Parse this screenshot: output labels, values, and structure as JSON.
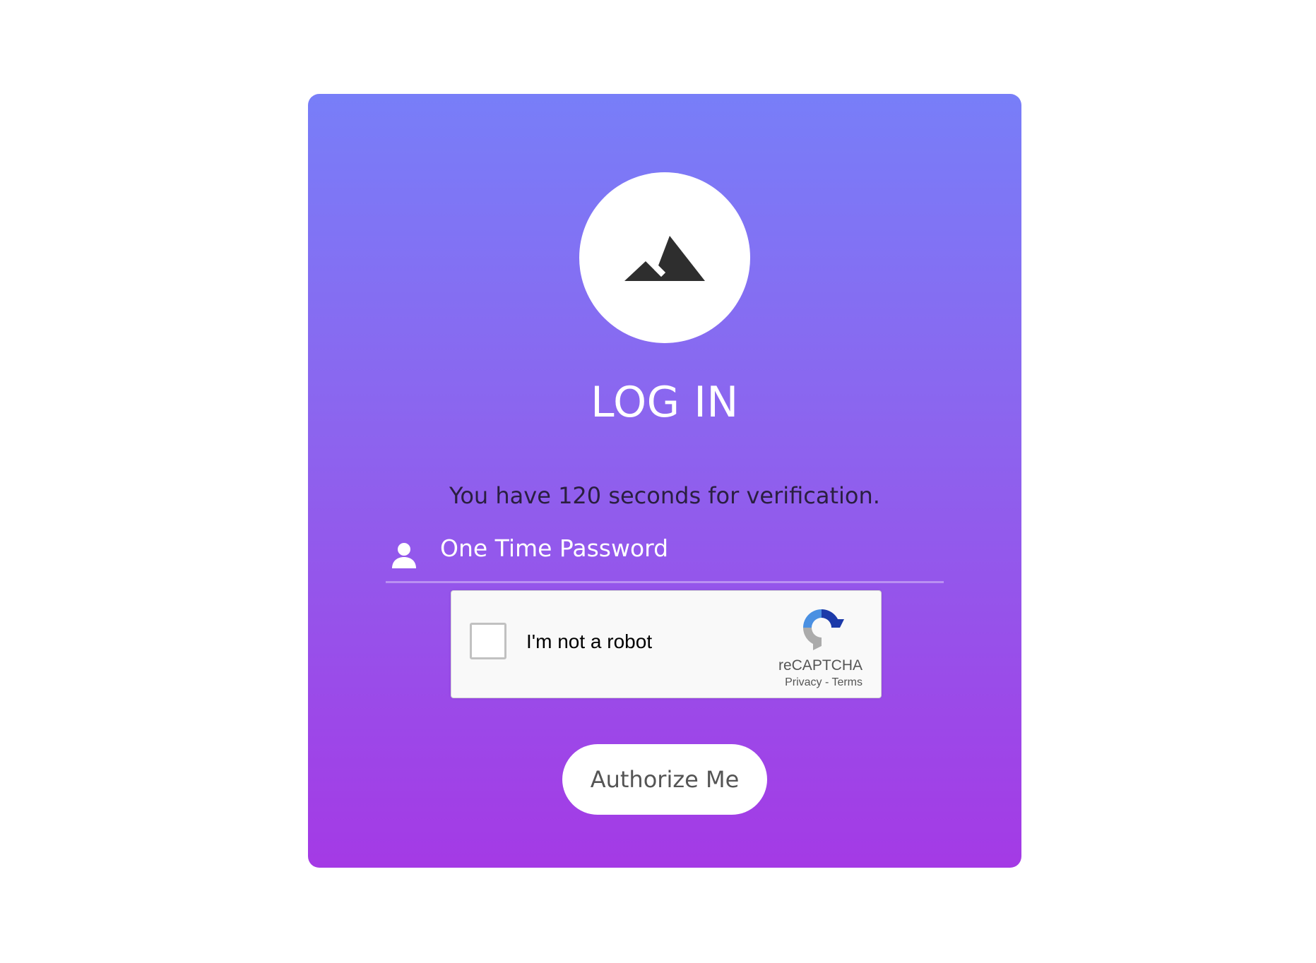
{
  "login": {
    "title": "LOG IN",
    "subtitle": "You have 120 seconds for verification.",
    "otp_field": {
      "placeholder": "One Time Password",
      "value": "",
      "icon": "user-icon"
    },
    "captcha": {
      "label": "I'm not a robot",
      "brand": "reCAPTCHA",
      "links": "Privacy - Terms",
      "checked": false
    },
    "submit_label": "Authorize Me",
    "logo_icon": "mountain-icon"
  },
  "colors": {
    "gradient_top": "#787ef8",
    "gradient_bottom": "#a43ae5",
    "button_bg": "#ffffff",
    "button_text": "#555555",
    "subtitle_text": "#2a1f40"
  }
}
